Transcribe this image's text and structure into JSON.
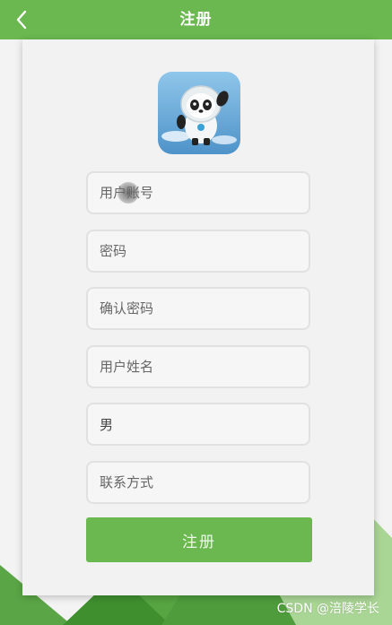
{
  "header": {
    "title": "注册"
  },
  "form": {
    "username_placeholder": "用户账号",
    "password_placeholder": "密码",
    "confirm_password_placeholder": "确认密码",
    "name_placeholder": "用户姓名",
    "gender_value": "男",
    "contact_placeholder": "联系方式",
    "submit_label": "注册"
  },
  "watermark": "CSDN @涪陵学长",
  "colors": {
    "accent": "#6ab84f",
    "button": "#6bb850",
    "field_border": "#e1e1e1"
  }
}
